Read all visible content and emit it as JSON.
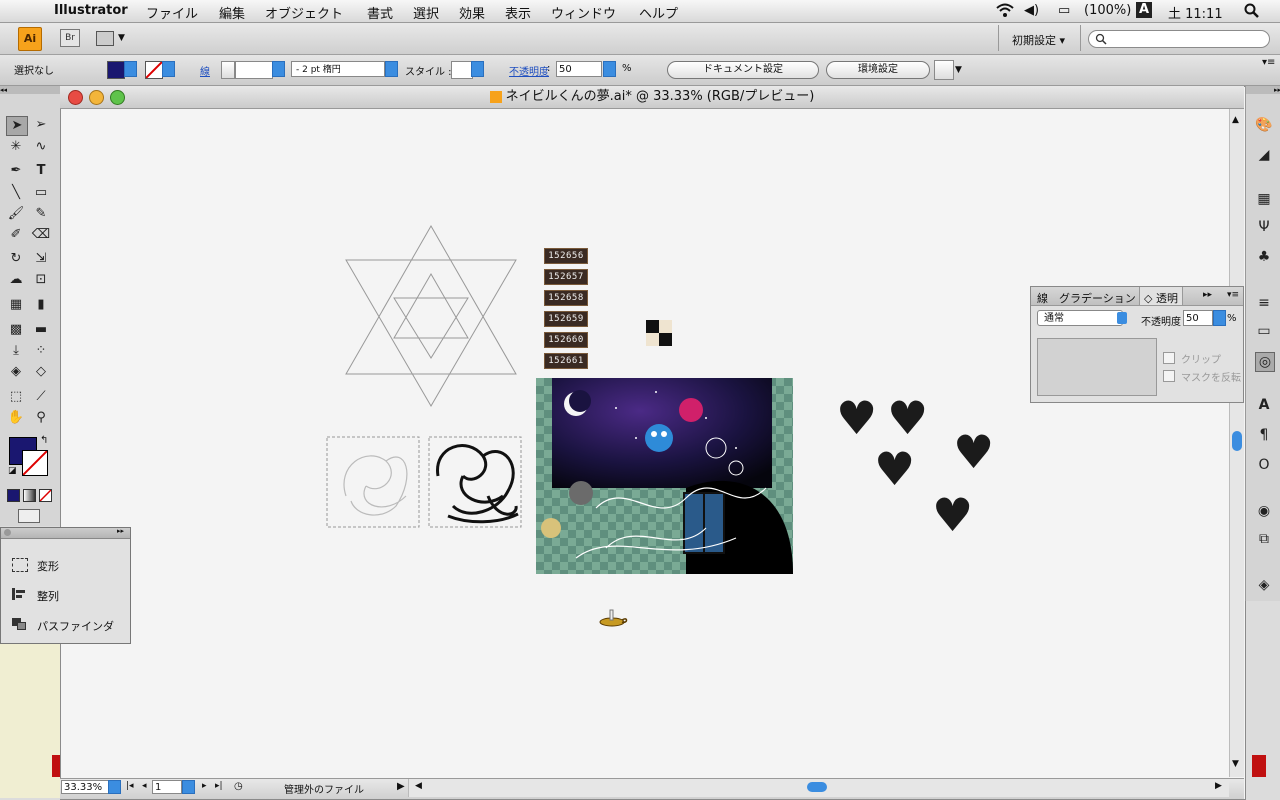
{
  "menubar": {
    "app_name": "Illustrator",
    "items": [
      "ファイル",
      "編集",
      "オブジェクト",
      "書式",
      "選択",
      "効果",
      "表示",
      "ウィンドウ",
      "ヘルプ"
    ],
    "battery": "(100%)",
    "input_mode": "A",
    "clock": "土 11:11"
  },
  "appbar": {
    "ai_label": "Ai",
    "br_label": "Br",
    "workspace": "初期設定 ▾"
  },
  "controlbar": {
    "selection": "選択なし",
    "stroke_label": "線",
    "stroke_profile": "-   2 pt 楕円",
    "style_label": "スタイル :",
    "opacity_label": "不透明度",
    "opacity_value": "50",
    "opacity_unit": "%",
    "doc_setup": "ドキュメント設定",
    "prefs": "環境設定"
  },
  "document": {
    "title": "ネイビルくんの夢.ai* @ 33.33% (RGB/プレビュー)",
    "zoom": "33.33%",
    "page": "1",
    "status": "管理外のファイル"
  },
  "artboard": {
    "counters": [
      "152656",
      "152657",
      "152658",
      "152659",
      "152660",
      "152661"
    ]
  },
  "panel_left": {
    "items": [
      {
        "label": "変形",
        "icon": "transform-icon"
      },
      {
        "label": "整列",
        "icon": "align-icon"
      },
      {
        "label": "パスファインダ",
        "icon": "pathfinder-icon"
      }
    ]
  },
  "panel_right": {
    "tabs": [
      "線",
      "グラデーション",
      "◇ 透明"
    ],
    "blend_mode": "通常",
    "opacity_label": "不透明度 :",
    "opacity_value": "50",
    "opacity_unit": "%",
    "clip_label": "クリップ",
    "invert_mask_label": "マスクを反転"
  },
  "colors": {
    "fill": "#1a1770",
    "accent": "#3b8de0"
  }
}
